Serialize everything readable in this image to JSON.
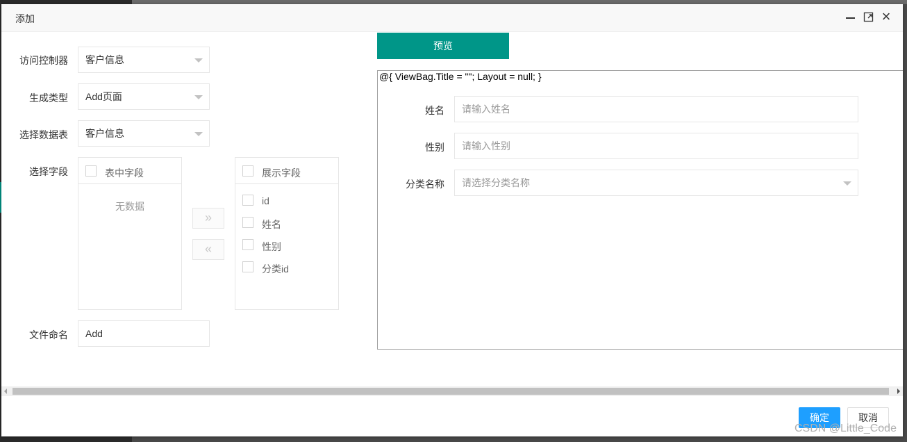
{
  "dialog": {
    "title": "添加",
    "minimize_icon": "minimize-icon",
    "maximize_icon": "maximize-icon",
    "close_icon": "close-icon",
    "close_glyph": "×"
  },
  "form": {
    "controller": {
      "label": "访问控制器",
      "value": "客户信息"
    },
    "gen_type": {
      "label": "生成类型",
      "value": "Add页面"
    },
    "data_table": {
      "label": "选择数据表",
      "value": "客户信息"
    },
    "fields": {
      "label": "选择字段"
    },
    "file_name": {
      "label": "文件命名",
      "value": "Add"
    }
  },
  "transfer": {
    "left": {
      "title": "表中字段",
      "empty_text": "无数据"
    },
    "right": {
      "title": "展示字段",
      "items": [
        "id",
        "姓名",
        "性别",
        "分类id"
      ]
    },
    "to_right_glyph": "»",
    "to_left_glyph": "«"
  },
  "preview": {
    "button_label": "预览",
    "code": "@{ ViewBag.Title = \"\"; Layout = null; }",
    "fields": [
      {
        "label": "姓名",
        "placeholder": "请输入姓名",
        "type": "input"
      },
      {
        "label": "性别",
        "placeholder": "请输入性别",
        "type": "input"
      },
      {
        "label": "分类名称",
        "placeholder": "请选择分类名称",
        "type": "select"
      }
    ]
  },
  "footer": {
    "ok_label": "确定",
    "cancel_label": "取消"
  },
  "watermark": "CSDN @Little_Code",
  "colors": {
    "primary": "#009688",
    "ok": "#1e9fff"
  }
}
